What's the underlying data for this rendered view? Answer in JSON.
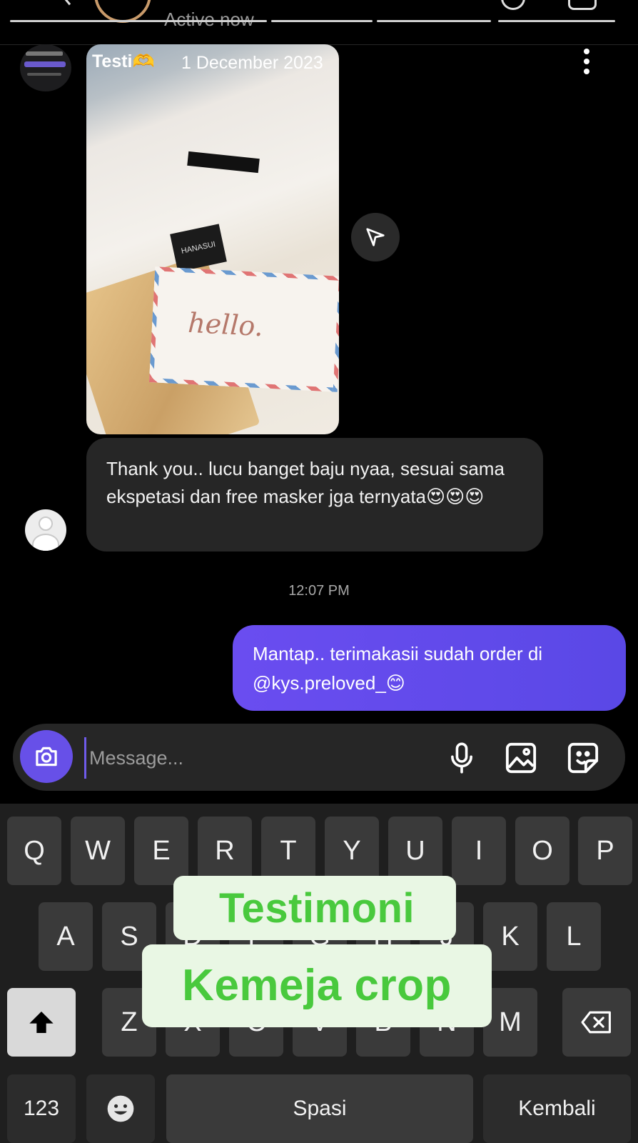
{
  "header": {
    "status_text": "Active now"
  },
  "story_reply": {
    "label": "Testi",
    "date": "1 December 2023",
    "photo": {
      "brand_tag": "HANASUI",
      "card_text": "hello."
    }
  },
  "messages": [
    {
      "direction": "incoming",
      "text": "Thank you.. lucu banget baju nyaa, sesuai sama ekspetasi dan free masker jga ternyata😍😍😍"
    },
    {
      "direction": "outgoing",
      "text": "Mantap.. terimakasii sudah order di @kys.preloved_😊"
    }
  ],
  "timestamp": "12:07 PM",
  "composer": {
    "placeholder": "Message..."
  },
  "keyboard": {
    "row1": [
      "Q",
      "W",
      "E",
      "R",
      "T",
      "Y",
      "U",
      "I",
      "O",
      "P"
    ],
    "row2": [
      "A",
      "S",
      "D",
      "F",
      "G",
      "H",
      "J",
      "K",
      "L"
    ],
    "row3": [
      "Z",
      "X",
      "C",
      "V",
      "B",
      "N",
      "M"
    ],
    "numbers_key": "123",
    "space_key": "Spasi",
    "return_key": "Kembali"
  },
  "overlay": {
    "line1": "Testimoni",
    "line2": "Kemeja crop",
    "color": "#49c93d"
  },
  "colors": {
    "accent": "#6750e8",
    "bubble_in": "#262626",
    "background": "#000000"
  }
}
